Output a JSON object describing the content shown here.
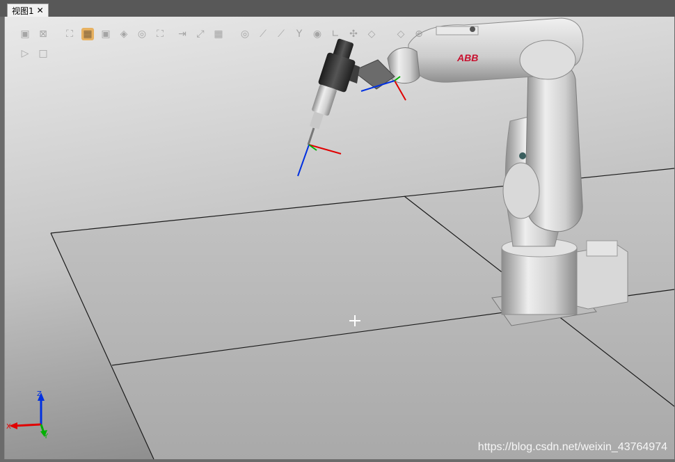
{
  "tab": {
    "label": "视图1",
    "close_glyph": "✕"
  },
  "brand": {
    "logo_text": "ABB",
    "logo_color": "#c8102e"
  },
  "axes": {
    "x": "X",
    "y": "Y",
    "z": "Z",
    "x_color": "#e00000",
    "y_color": "#00b000",
    "z_color": "#0030e0"
  },
  "watermark": "https://blog.csdn.net/weixin_43764974",
  "toolbar_icons": [
    "view-solid-icon",
    "view-wire-icon",
    "zoom-fit-icon",
    "select-body-icon",
    "select-part-icon",
    "select-robot-icon",
    "select-target-icon",
    "select-path-icon",
    "snap-object-icon",
    "snap-edge-icon",
    "snap-middle-icon",
    "snap-grid-icon",
    "snap-center-icon",
    "measure-distance-icon",
    "measure-point-icon",
    "measure-angle-icon",
    "measure-diameter-icon",
    "measure-min-icon",
    "measure-clear-icon",
    "measure-axis-icon",
    "freehand-jog-icon",
    "play-icon",
    "stop-icon"
  ]
}
